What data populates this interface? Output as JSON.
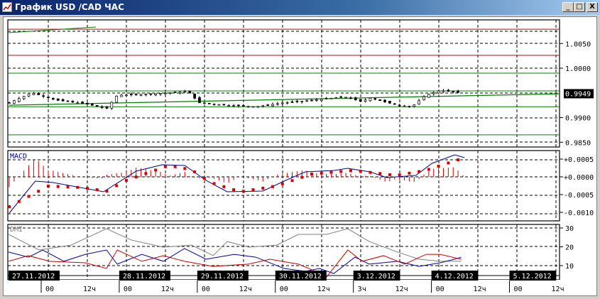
{
  "window": {
    "title": "График USD /CAD  ЧАС",
    "minimize_label": "_",
    "maximize_label": "□",
    "close_label": "X"
  },
  "colors": {
    "up": "#000000",
    "red": "#cc0000",
    "green": "#008000",
    "blue": "#000099",
    "gray": "#808080",
    "macd_signal": "#dd0000"
  },
  "chart_data": {
    "type": "line",
    "time_unit": "hours since 27.11.2012 00:00",
    "price_axis": {
      "ticks": [
        "1.0050",
        "1.0000",
        "0.9900",
        "0.9850"
      ],
      "tick_values": [
        1.005,
        1.0,
        0.99,
        0.985
      ],
      "current_label": "0.9949",
      "current_value": 0.9949
    },
    "price_path": [
      [
        -12,
        0.993
      ],
      [
        -5,
        0.995
      ],
      [
        2.6,
        0.9935
      ],
      [
        11.4,
        0.9928
      ],
      [
        17.9,
        0.9918
      ],
      [
        21.2,
        0.9945
      ],
      [
        33,
        0.9948
      ],
      [
        43,
        0.9953
      ],
      [
        46.3,
        0.993
      ],
      [
        55,
        0.9925
      ],
      [
        63.8,
        0.9922
      ],
      [
        72.5,
        0.993
      ],
      [
        81,
        0.9935
      ],
      [
        91,
        0.9942
      ],
      [
        96.5,
        0.9932
      ],
      [
        98.7,
        0.994
      ],
      [
        107.4,
        0.9925
      ],
      [
        111.8,
        0.9922
      ],
      [
        116,
        0.9945
      ],
      [
        120.5,
        0.9955
      ],
      [
        127,
        0.995
      ]
    ],
    "levels": [
      {
        "value": 1.0079,
        "color": "red"
      },
      {
        "value": 1.0026,
        "color": "red"
      },
      {
        "value": 0.999,
        "color": "green"
      },
      {
        "value": 0.9954,
        "color": "green"
      },
      {
        "value": 0.9922,
        "color": "green"
      },
      {
        "value": 0.9865,
        "color": "green"
      }
    ],
    "trendline": [
      [
        -12,
        0.9925
      ],
      [
        157,
        0.9948
      ]
    ],
    "macd": {
      "label": "MACD",
      "ticks": [
        "+0.0005",
        "+0.0000",
        "-0.0005",
        "-0.0010"
      ],
      "tick_values": [
        0.0005,
        0,
        -0.0005,
        -0.001
      ],
      "main": [
        [
          -12,
          -0.00102
        ],
        [
          -4,
          -0.00012
        ],
        [
          1.5,
          -0.00016
        ],
        [
          17,
          -0.00042
        ],
        [
          27,
          0.00016
        ],
        [
          35,
          0.00034
        ],
        [
          42,
          0.00032
        ],
        [
          48.5,
          -0.0001
        ],
        [
          55,
          -0.00042
        ],
        [
          66,
          -0.0004
        ],
        [
          72.5,
          -0.00012
        ],
        [
          79,
          0.00014
        ],
        [
          88,
          0.00018
        ],
        [
          92,
          0.00024
        ],
        [
          99,
          0.00014
        ],
        [
          104,
          -2e-05
        ],
        [
          113,
          4e-05
        ],
        [
          118,
          0.00038
        ],
        [
          125,
          0.00062
        ],
        [
          128,
          0.00054
        ]
      ],
      "signal": [
        [
          -12,
          -0.00084
        ],
        [
          0,
          -0.00026
        ],
        [
          10,
          -0.0003
        ],
        [
          18,
          -0.0004
        ],
        [
          24,
          -0.0001
        ],
        [
          37,
          0.00032
        ],
        [
          44,
          0.0002
        ],
        [
          50,
          -0.00016
        ],
        [
          59,
          -0.00042
        ],
        [
          70,
          -0.00026
        ],
        [
          81,
          8e-05
        ],
        [
          94,
          0.00018
        ],
        [
          107,
          4e-05
        ],
        [
          116,
          0.00018
        ],
        [
          128,
          0.00054
        ]
      ]
    },
    "dmi": {
      "label": "DMI",
      "ticks": [
        "30",
        "20",
        "10"
      ],
      "tick_values": [
        30,
        20,
        10
      ],
      "adx": [
        [
          -12.2,
          26.6
        ],
        [
          -2.8,
          18.3
        ],
        [
          7,
          20.9
        ],
        [
          17.9,
          29.6
        ],
        [
          25.5,
          23.6
        ],
        [
          35.4,
          19.8
        ],
        [
          44.1,
          20.9
        ],
        [
          50.7,
          15.3
        ],
        [
          55,
          22.8
        ],
        [
          61.6,
          19.8
        ],
        [
          70.3,
          20.9
        ],
        [
          76.9,
          26.6
        ],
        [
          85.6,
          26.6
        ],
        [
          92.1,
          29.6
        ],
        [
          98.7,
          22.8
        ],
        [
          107.4,
          17.2
        ],
        [
          114,
          13.4
        ],
        [
          120.5,
          12.3
        ],
        [
          127,
          12.3
        ]
      ],
      "plus_di": [
        [
          -12.2,
          17.2
        ],
        [
          -6.1,
          14.5
        ],
        [
          -1.7,
          18.3
        ],
        [
          4.8,
          12.3
        ],
        [
          11.4,
          16
        ],
        [
          17.9,
          18.3
        ],
        [
          21.2,
          10.8
        ],
        [
          28.8,
          16
        ],
        [
          35.4,
          12.3
        ],
        [
          41.9,
          19.1
        ],
        [
          48.5,
          13.4
        ],
        [
          57.2,
          16
        ],
        [
          63.8,
          14.5
        ],
        [
          72.5,
          8.5
        ],
        [
          79,
          7
        ],
        [
          83.4,
          8.5
        ],
        [
          87.8,
          5.8
        ],
        [
          94.3,
          14.5
        ],
        [
          98.7,
          10.8
        ],
        [
          107.4,
          12.3
        ],
        [
          114,
          9.6
        ],
        [
          120.5,
          11.5
        ],
        [
          124.9,
          13.4
        ],
        [
          127,
          14.5
        ]
      ],
      "minus_di": [
        [
          -12.2,
          12.3
        ],
        [
          -6.1,
          15.3
        ],
        [
          0.4,
          12.3
        ],
        [
          11.4,
          11.5
        ],
        [
          17.9,
          8.5
        ],
        [
          21.2,
          18.3
        ],
        [
          28.8,
          12.3
        ],
        [
          35.4,
          15.3
        ],
        [
          41.9,
          12.3
        ],
        [
          50.7,
          9.6
        ],
        [
          61.6,
          10.8
        ],
        [
          68.1,
          13.4
        ],
        [
          76.9,
          10.8
        ],
        [
          81.2,
          7.7
        ],
        [
          85.6,
          4
        ],
        [
          92.1,
          18.3
        ],
        [
          96.5,
          12.3
        ],
        [
          103.1,
          15.3
        ],
        [
          109.6,
          10.8
        ],
        [
          116.2,
          16
        ],
        [
          120.5,
          16
        ],
        [
          127,
          13.4
        ]
      ]
    },
    "dates": [
      {
        "label": "27.11.2012",
        "t": 0,
        "ticks": [
          "00",
          "12ч"
        ]
      },
      {
        "label": "28.11.2012",
        "t": 24,
        "ticks": [
          "00",
          "12ч"
        ]
      },
      {
        "label": "29.11.2012",
        "t": 48,
        "ticks": [
          "00",
          "12ч"
        ]
      },
      {
        "label": "30.11.2012",
        "t": 72,
        "ticks": [
          "00",
          "12ч"
        ]
      },
      {
        "label": "3.12.2012",
        "t": 96,
        "ticks": [
          "3ч",
          "12ч"
        ]
      },
      {
        "label": "4.12.2012",
        "t": 120,
        "ticks": [
          "00",
          "12ч"
        ]
      },
      {
        "label": "5.12.2012",
        "t": 144,
        "ticks": [
          "00",
          "12ч"
        ]
      }
    ]
  }
}
